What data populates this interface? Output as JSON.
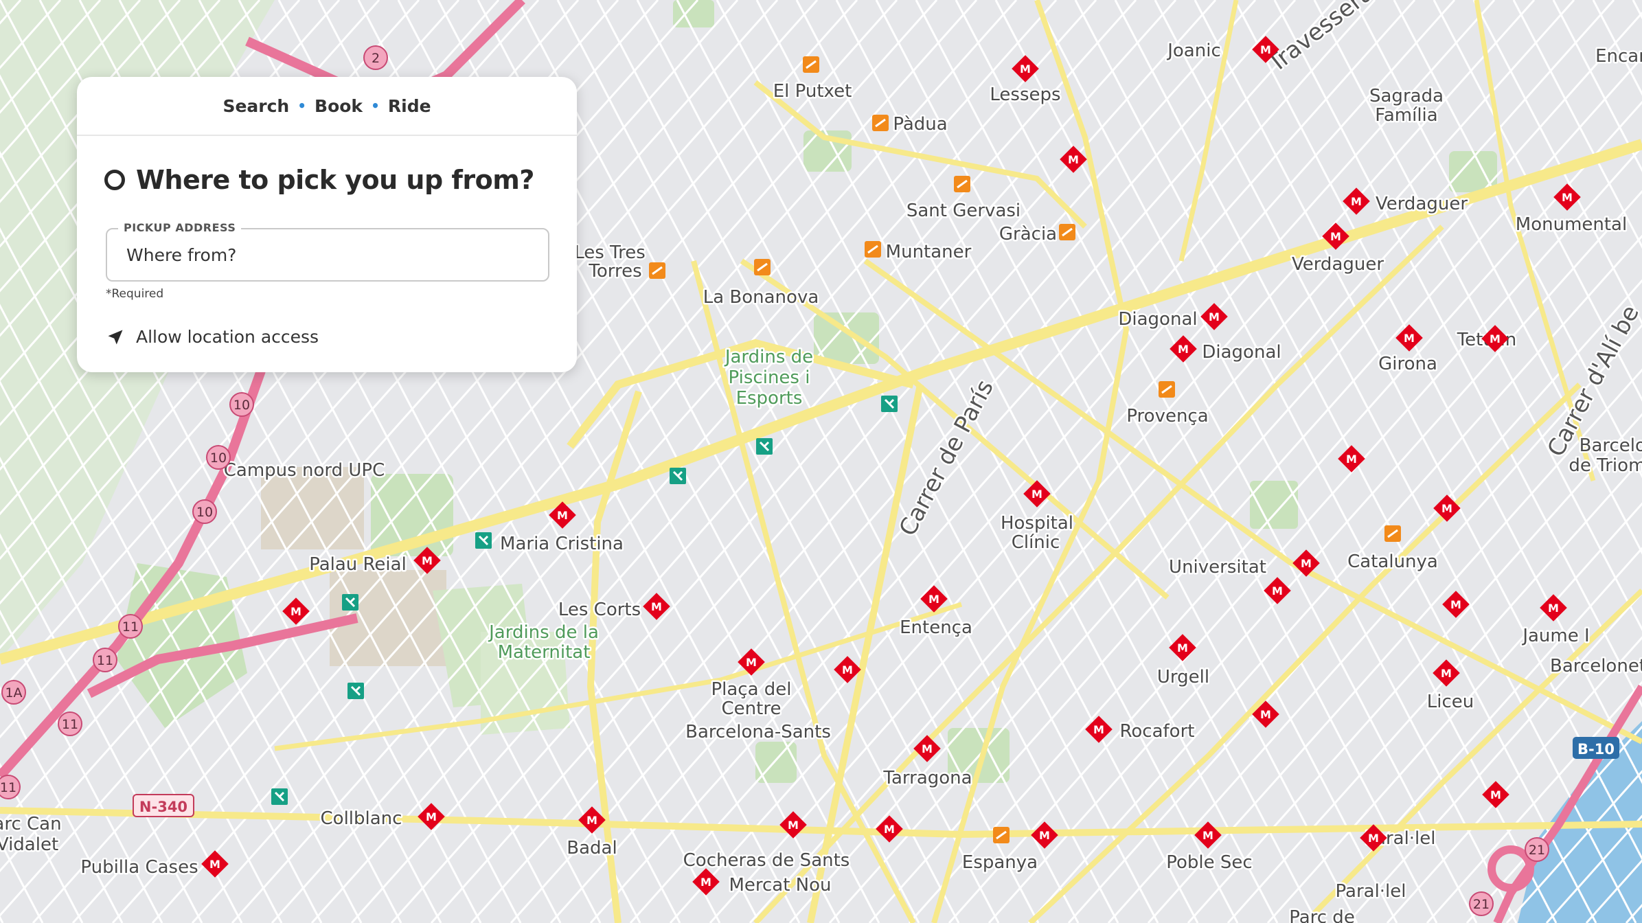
{
  "card": {
    "steps": [
      "Search",
      "Book",
      "Ride"
    ],
    "question": "Where to pick you up from?",
    "field_label": "PICKUP ADDRESS",
    "field_placeholder": "Where from?",
    "required_note": "*Required",
    "location_link": "Allow location access"
  },
  "map": {
    "colors": {
      "metro": "#e3001b",
      "fgc": "#f28a1a",
      "tram": "#16a085",
      "motorway": "#e9759a",
      "primary_road": "#f7e98a",
      "park": "#c7e3b6",
      "water": "#8fc3e6"
    },
    "place_labels": [
      {
        "text": "El Putxet"
      },
      {
        "text": "Pàdua"
      },
      {
        "text": "Lesseps"
      },
      {
        "text": "Joanic"
      },
      {
        "text": "Travessera"
      },
      {
        "text": "Sagrada"
      },
      {
        "text": "Família"
      },
      {
        "text": "Encar"
      },
      {
        "text": "Sant Gervasi"
      },
      {
        "text": "Gràcia"
      },
      {
        "text": "Verdaguer"
      },
      {
        "text": "Monumental"
      },
      {
        "text": "Les Tres"
      },
      {
        "text": "Torres"
      },
      {
        "text": "Muntaner"
      },
      {
        "text": "La Bonanova"
      },
      {
        "text": "Verdaguer"
      },
      {
        "text": "Diagonal"
      },
      {
        "text": "Diagonal"
      },
      {
        "text": "Girona"
      },
      {
        "text": "Tetuan"
      },
      {
        "text": "Provença"
      },
      {
        "text": "Carrer d'Alí be"
      },
      {
        "text": "Barcelona-Arc"
      },
      {
        "text": "de Triomf"
      },
      {
        "text": "Campus nord UPC"
      },
      {
        "text": "Carrer de París"
      },
      {
        "text": "Hospital"
      },
      {
        "text": "Clínic"
      },
      {
        "text": "Maria Cristina"
      },
      {
        "text": "Palau Reial"
      },
      {
        "text": "Universitat"
      },
      {
        "text": "Catalunya"
      },
      {
        "text": "Les Corts"
      },
      {
        "text": "Entença"
      },
      {
        "text": "Jaume I"
      },
      {
        "text": "Barceloneta"
      },
      {
        "text": "Urgell"
      },
      {
        "text": "Liceu"
      },
      {
        "text": "Plaça del"
      },
      {
        "text": "Centre"
      },
      {
        "text": "Barcelona-Sants"
      },
      {
        "text": "Rocafort"
      },
      {
        "text": "Tarragona"
      },
      {
        "text": "arc Can"
      },
      {
        "text": "Vidalet"
      },
      {
        "text": "Collblanc"
      },
      {
        "text": "Badal"
      },
      {
        "text": "Espanya"
      },
      {
        "text": "Poble Sec"
      },
      {
        "text": "Paral·lel"
      },
      {
        "text": "Pubilla Cases"
      },
      {
        "text": "Cocheras de Sants"
      },
      {
        "text": "Mercat Nou"
      },
      {
        "text": "Paral·lel"
      },
      {
        "text": "Parc de"
      }
    ],
    "park_labels": [
      {
        "text": "Jardins de"
      },
      {
        "text": "Piscines i"
      },
      {
        "text": "Esports"
      },
      {
        "text": "Jardins de la"
      },
      {
        "text": "Maternitat"
      }
    ],
    "road_shields": [
      {
        "text": "2"
      },
      {
        "text": "10"
      },
      {
        "text": "10"
      },
      {
        "text": "10"
      },
      {
        "text": "11"
      },
      {
        "text": "11"
      },
      {
        "text": "11"
      },
      {
        "text": "1A"
      },
      {
        "text": "11"
      },
      {
        "text": "21"
      },
      {
        "text": "21"
      }
    ],
    "road_refs": [
      {
        "text": "N-340"
      },
      {
        "text": "B-10"
      }
    ]
  }
}
